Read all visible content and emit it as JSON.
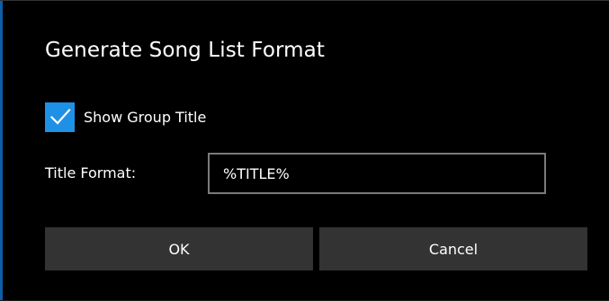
{
  "dialog": {
    "title": "Generate Song List Format",
    "show_group_title": {
      "label": "Show Group Title",
      "checked": true
    },
    "title_format": {
      "label": "Title Format:",
      "value": "%TITLE%"
    },
    "buttons": {
      "ok": "OK",
      "cancel": "Cancel"
    }
  },
  "colors": {
    "background": "#000000",
    "accent": "#1e90e6",
    "button_bg": "#333333",
    "input_border": "#7a7a7a",
    "text": "#ffffff"
  },
  "icons": {
    "checkmark": "checkmark-icon"
  }
}
